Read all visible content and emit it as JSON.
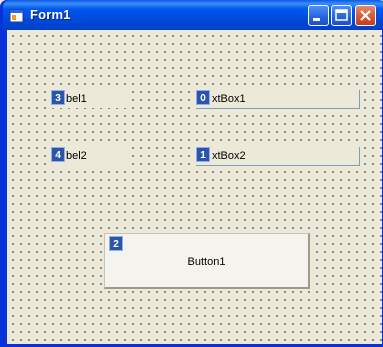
{
  "window": {
    "title": "Form1",
    "controls": {
      "minimize_icon": "minimize-icon",
      "maximize_icon": "maximize-icon",
      "close_icon": "close-icon"
    }
  },
  "form": {
    "label1": {
      "tab_index": "3",
      "text": "bel1"
    },
    "label2": {
      "tab_index": "4",
      "text": "bel2"
    },
    "textbox1": {
      "tab_index": "0",
      "text": "xtBox1"
    },
    "textbox2": {
      "tab_index": "1",
      "text": "xtBox2"
    },
    "button1": {
      "tab_index": "2",
      "text": "Button1"
    }
  },
  "colors": {
    "titlebar": "#0054e3",
    "client_bg": "#ece9d8",
    "tab_badge": "#2b55a8"
  }
}
